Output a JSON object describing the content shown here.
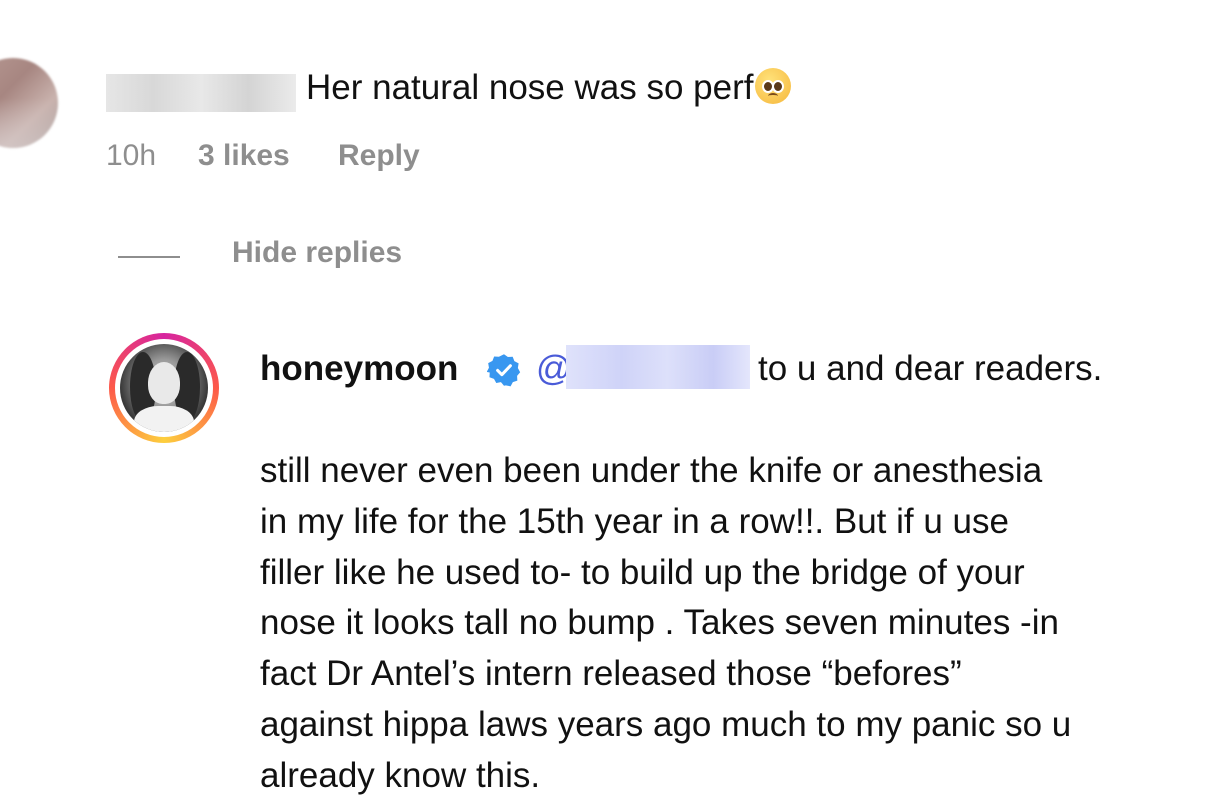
{
  "comment": {
    "text": "Her natural nose was so perf",
    "emoji": "tearful-face-emoji",
    "time": "10h",
    "likes": "3 likes",
    "reply_label": "Reply"
  },
  "thread": {
    "hide_replies_label": "Hide replies"
  },
  "reply": {
    "username": "honeymoon",
    "verified": true,
    "mention_prefix": "@",
    "head_text": "to u and dear readers.",
    "body_lines": [
      "still never even been under the knife or anesthesia",
      "in my life for the 15th year in a row!!. But if u use",
      "filler like he used to- to build up the bridge of your",
      "nose it looks tall no bump . Takes seven minutes -in",
      "fact Dr Antel’s intern released those “befores”",
      "against hippa laws years ago much to my panic so u",
      "already know this."
    ]
  },
  "colors": {
    "meta_gray": "#8e8e8e",
    "verified_blue": "#3897f0",
    "mention_blue": "#4a5bd8"
  }
}
